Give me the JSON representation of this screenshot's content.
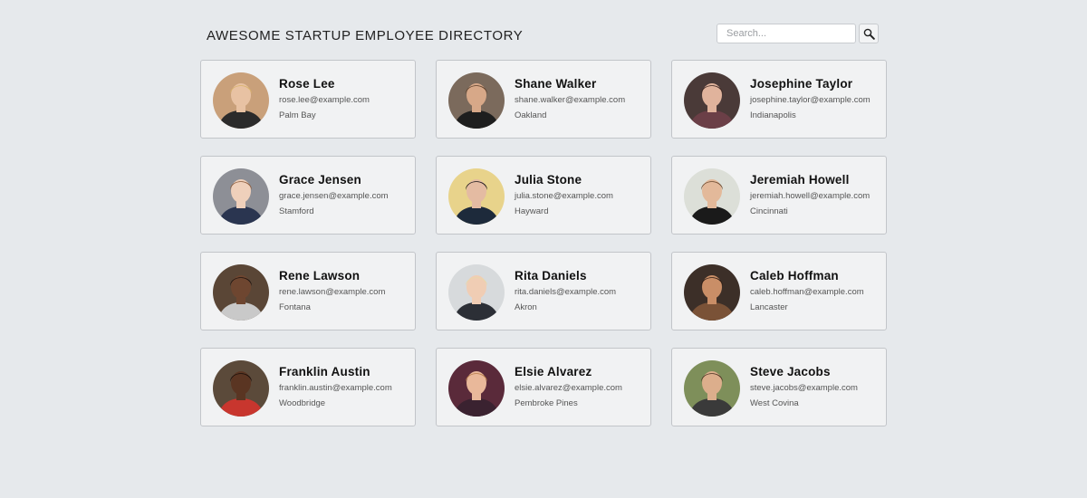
{
  "header": {
    "title": "AWESOME STARTUP EMPLOYEE DIRECTORY"
  },
  "search": {
    "placeholder": "Search...",
    "icon": "magnifier-icon"
  },
  "colors": {
    "background": "#e6e9ec",
    "card": "#f1f2f3",
    "card_border": "#c2c5c9"
  },
  "employees": [
    {
      "name": "Rose Lee",
      "email": "rose.lee@example.com",
      "city": "Palm Bay",
      "bg": "#c9a07a",
      "skin": "#e8c2a3",
      "hair": "#d9b36a",
      "shirt": "#2b2b2b"
    },
    {
      "name": "Shane Walker",
      "email": "shane.walker@example.com",
      "city": "Oakland",
      "bg": "#7b6a5c",
      "skin": "#d7a888",
      "hair": "#5b3e2a",
      "shirt": "#1e1e1e"
    },
    {
      "name": "Josephine Taylor",
      "email": "josephine.taylor@example.com",
      "city": "Indianapolis",
      "bg": "#4a3a38",
      "skin": "#e0b39c",
      "hair": "#3a2420",
      "shirt": "#6b3f47"
    },
    {
      "name": "Grace Jensen",
      "email": "grace.jensen@example.com",
      "city": "Stamford",
      "bg": "#8d8f96",
      "skin": "#efd0bb",
      "hair": "#8a5a3a",
      "shirt": "#2a3550"
    },
    {
      "name": "Julia Stone",
      "email": "julia.stone@example.com",
      "city": "Hayward",
      "bg": "#e8d38b",
      "skin": "#e4bba2",
      "hair": "#1a1618",
      "shirt": "#1d2a3b"
    },
    {
      "name": "Jeremiah Howell",
      "email": "jeremiah.howell@example.com",
      "city": "Cincinnati",
      "bg": "#dcdfd8",
      "skin": "#e3b99a",
      "hair": "#6a4a30",
      "shirt": "#1a1a1a"
    },
    {
      "name": "Rene Lawson",
      "email": "rene.lawson@example.com",
      "city": "Fontana",
      "bg": "#5a4636",
      "skin": "#6e4630",
      "hair": "#1e1410",
      "shirt": "#c9c9c9"
    },
    {
      "name": "Rita Daniels",
      "email": "rita.daniels@example.com",
      "city": "Akron",
      "bg": "#d7dadc",
      "skin": "#f0cdb4",
      "hair": "#e9d8a8",
      "shirt": "#2c2f36"
    },
    {
      "name": "Caleb Hoffman",
      "email": "caleb.hoffman@example.com",
      "city": "Lancaster",
      "bg": "#3c2f28",
      "skin": "#c98e67",
      "hair": "#2a1a12",
      "shirt": "#7a5237"
    },
    {
      "name": "Franklin Austin",
      "email": "franklin.austin@example.com",
      "city": "Woodbridge",
      "bg": "#5b4a3a",
      "skin": "#5a3522",
      "hair": "#1a0f0a",
      "shirt": "#c8362e"
    },
    {
      "name": "Elsie Alvarez",
      "email": "elsie.alvarez@example.com",
      "city": "Pembroke Pines",
      "bg": "#5a2a3a",
      "skin": "#e9b89a",
      "hair": "#b47b48",
      "shirt": "#3a2230"
    },
    {
      "name": "Steve Jacobs",
      "email": "steve.jacobs@example.com",
      "city": "West Covina",
      "bg": "#7e8f5a",
      "skin": "#dcae8c",
      "hair": "#4a3222",
      "shirt": "#3a3a3a"
    }
  ]
}
